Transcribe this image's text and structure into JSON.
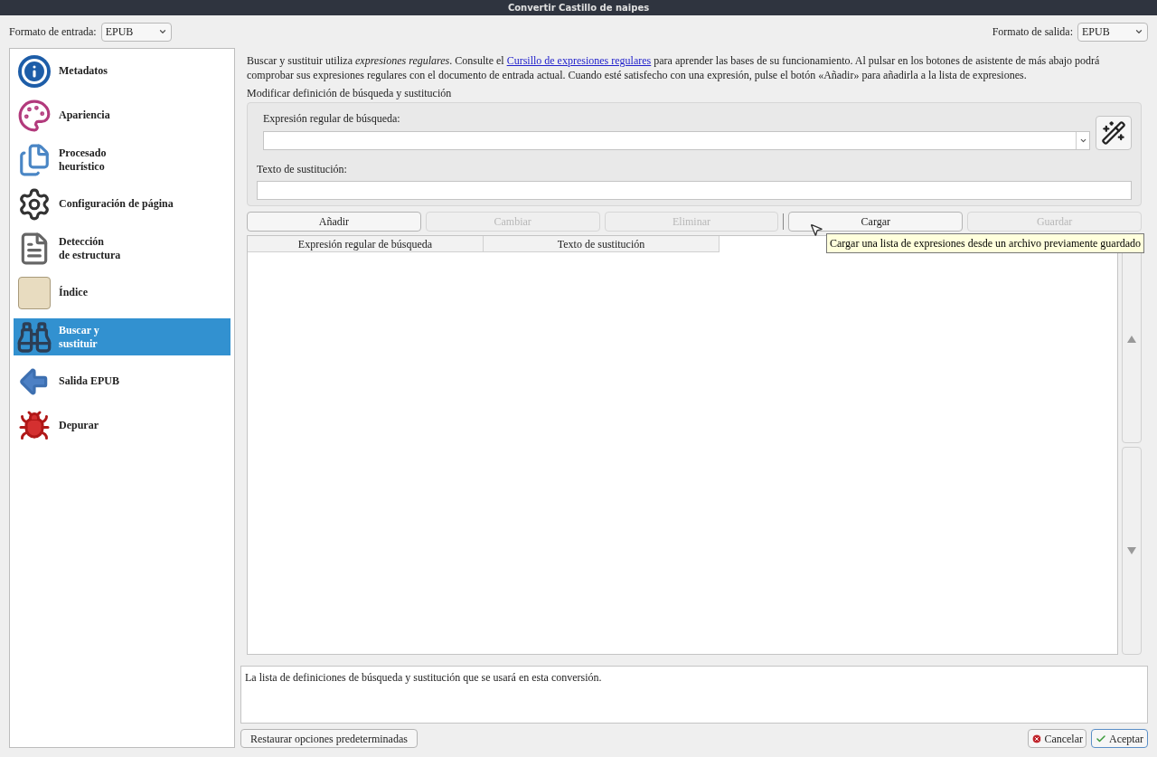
{
  "window": {
    "title": "Convertir Castillo de naipes"
  },
  "input_format": {
    "label": "Formato de entrada:",
    "value": "EPUB"
  },
  "output_format": {
    "label": "Formato de salida:",
    "value": "EPUB"
  },
  "sidebar": {
    "items": [
      {
        "label": "Metadatos",
        "selected": false
      },
      {
        "label": "Apariencia",
        "selected": false
      },
      {
        "label": "Procesado\nheurístico",
        "selected": false
      },
      {
        "label": "Configuración de página",
        "selected": false
      },
      {
        "label": "Detección\nde estructura",
        "selected": false
      },
      {
        "label": "Índice",
        "selected": false
      },
      {
        "label": "Buscar y\nsustituir",
        "selected": true
      },
      {
        "label": "Salida EPUB",
        "selected": false
      },
      {
        "label": "Depurar",
        "selected": false
      }
    ]
  },
  "description": {
    "before": "Buscar y sustituir utiliza *expresiones regulares*. Consulte el",
    "link": "Cursillo de expresiones regulares",
    "after": "para aprender las bases de su funcionamiento. Al pulsar en los botones de asistente de más abajo podrá comprobar sus expresiones regulares con el documento de entrada actual. Cuando esté satisfecho con una expresión, pulse el botón «Añadir» para añadirla a la lista de expresiones."
  },
  "group": {
    "title": "Modificar definición de búsqueda y sustitución",
    "search_label": "Expresión regular de búsqueda:",
    "replace_label": "Texto de sustitución:"
  },
  "buttons": [
    {
      "label": "Añadir",
      "disabled": false
    },
    {
      "label": "Cambiar",
      "disabled": true
    },
    {
      "label": "Eliminar",
      "disabled": true
    },
    {
      "label": "Cargar",
      "disabled": false
    },
    {
      "label": "Guardar",
      "disabled": true
    }
  ],
  "tooltip": "Cargar una lista de expresiones desde un archivo previamente guardado",
  "table": {
    "columns": [
      "Expresión regular de búsqueda",
      "Texto de sustitución"
    ]
  },
  "help_text": "La lista de definiciones de búsqueda y sustitución que se usará en esta conversión.",
  "footer": {
    "restore": "Restaurar opciones predeterminadas",
    "cancel": "Cancelar",
    "accept": "Aceptar"
  }
}
